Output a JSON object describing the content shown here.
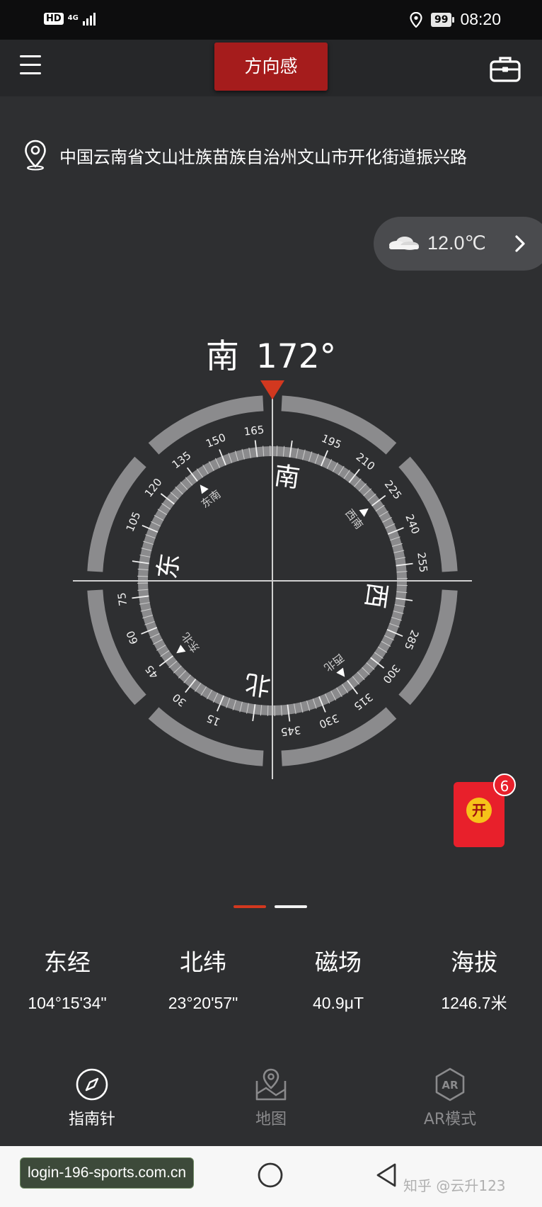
{
  "status_bar": {
    "hd": "HD",
    "network": "4G",
    "battery": "99",
    "time": "08:20"
  },
  "app_bar": {
    "title": "方向感",
    "menu_icon": "hamburger-menu-icon",
    "toolbox_icon": "toolbox-icon"
  },
  "location": {
    "icon": "location-pin-icon",
    "address": "中国云南省文山壮族苗族自治州文山市开化街道振兴路"
  },
  "weather": {
    "icon": "cloud-icon",
    "temperature": "12.0℃"
  },
  "compass": {
    "direction": "南",
    "degrees": "172°",
    "heading_value": 172,
    "cardinals": {
      "north": "北",
      "east": "东",
      "south": "南",
      "west": "西"
    },
    "intercardinals": {
      "northeast": "东北",
      "southeast": "东南",
      "southwest": "西南",
      "northwest": "西北"
    },
    "accent_color": "#d2381f"
  },
  "red_packet": {
    "label": "开",
    "badge": "6"
  },
  "pager": {
    "pages": 2,
    "active_color": "#d2381f"
  },
  "stats": [
    {
      "label": "东经",
      "value": "104°15'34\""
    },
    {
      "label": "北纬",
      "value": "23°20'57\""
    },
    {
      "label": "磁场",
      "value": "40.9μT"
    },
    {
      "label": "海拔",
      "value": "1246.7米"
    }
  ],
  "bottom_nav": [
    {
      "label": "指南针",
      "icon": "compass-icon",
      "active": true
    },
    {
      "label": "地图",
      "icon": "map-icon",
      "active": false
    },
    {
      "label": "AR模式",
      "icon": "ar-icon",
      "active": false
    }
  ],
  "system_nav": {
    "url": "login-196-sports.com.cn",
    "watermark": "知乎 @云升123"
  }
}
